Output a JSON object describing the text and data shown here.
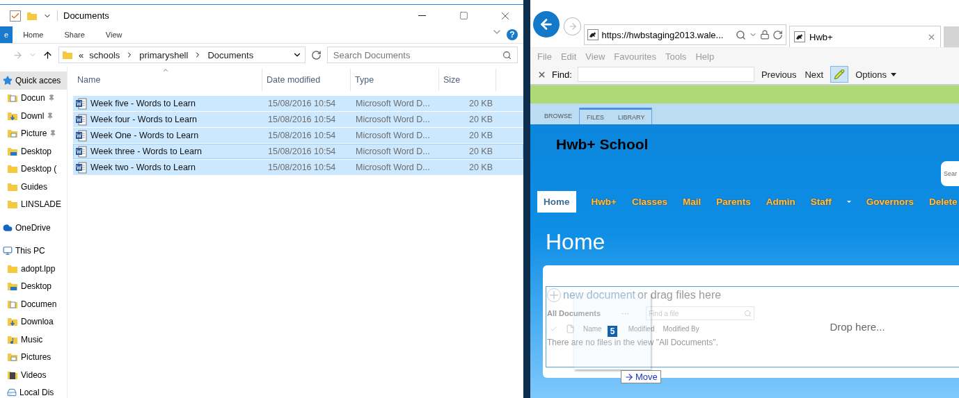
{
  "explorer": {
    "title": "Documents",
    "ribbon_tabs": [
      {
        "label": "e",
        "selected": true
      },
      {
        "label": "Home",
        "selected": false
      },
      {
        "label": "Share",
        "selected": false
      },
      {
        "label": "View",
        "selected": false
      }
    ],
    "help_label": "?",
    "breadcrumb": [
      "schools",
      "primaryshell",
      "Documents"
    ],
    "breadcrumb_overflow": "«",
    "search": {
      "placeholder": "Search Documents"
    },
    "sidebar": [
      {
        "label": "Quick acces",
        "kind": "star",
        "selected": true,
        "children": [
          {
            "label": "Docun",
            "kind": "documents",
            "pinned": true
          },
          {
            "label": "Downl",
            "kind": "downloads",
            "pinned": true
          },
          {
            "label": "Picture",
            "kind": "pictures",
            "pinned": true
          },
          {
            "label": "Desktop",
            "kind": "desktop",
            "pinned": false
          },
          {
            "label": "Desktop (",
            "kind": "folder",
            "pinned": false
          },
          {
            "label": "Guides",
            "kind": "folder",
            "pinned": false
          },
          {
            "label": "LINSLADE",
            "kind": "folder",
            "pinned": false
          }
        ]
      },
      {
        "label": "OneDrive",
        "kind": "cloud",
        "selected": false
      },
      {
        "label": "This PC",
        "kind": "pc",
        "selected": false,
        "children": [
          {
            "label": "adopt.lpp",
            "kind": "folder",
            "pinned": false
          },
          {
            "label": "Desktop",
            "kind": "desktop",
            "pinned": false
          },
          {
            "label": "Documen",
            "kind": "documents",
            "pinned": false
          },
          {
            "label": "Downloa",
            "kind": "downloads",
            "pinned": false
          },
          {
            "label": "Music",
            "kind": "music",
            "pinned": false
          },
          {
            "label": "Pictures",
            "kind": "pictures",
            "pinned": false
          },
          {
            "label": "Videos",
            "kind": "videos",
            "pinned": false
          },
          {
            "label": "Local Dis",
            "kind": "disk",
            "pinned": false
          }
        ]
      }
    ],
    "table": {
      "columns": [
        {
          "label": "Name",
          "sorted": true
        },
        {
          "label": "Date modified",
          "sorted": false
        },
        {
          "label": "Type",
          "sorted": false
        },
        {
          "label": "Size",
          "sorted": false
        }
      ],
      "rows": [
        {
          "name": "Week five - Words to Learn",
          "date": "15/08/2016 10:54",
          "type": "Microsoft Word D...",
          "size": "20 KB",
          "selected": true,
          "focused": false
        },
        {
          "name": "Week four - Words to Learn",
          "date": "15/08/2016 10:54",
          "type": "Microsoft Word D...",
          "size": "20 KB",
          "selected": true,
          "focused": false
        },
        {
          "name": "Week One - Words to Learn",
          "date": "15/08/2016 10:54",
          "type": "Microsoft Word D...",
          "size": "20 KB",
          "selected": true,
          "focused": false
        },
        {
          "name": "Week three - Words to Learn",
          "date": "15/08/2016 10:54",
          "type": "Microsoft Word D...",
          "size": "20 KB",
          "selected": true,
          "focused": true
        },
        {
          "name": "Week two - Words to Learn",
          "date": "15/08/2016 10:54",
          "type": "Microsoft Word D...",
          "size": "20 KB",
          "selected": true,
          "focused": false
        }
      ]
    }
  },
  "browser": {
    "url": "https://hwbstaging2013.wale...",
    "tab": {
      "label": "Hwb+"
    },
    "menu": [
      "File",
      "Edit",
      "View",
      "Favourites",
      "Tools",
      "Help"
    ],
    "find": {
      "label": "Find:",
      "buttons": [
        "Previous",
        "Next"
      ],
      "highlight_on": true,
      "options": "Options"
    }
  },
  "site": {
    "ribbon_tabs": [
      {
        "label": "BROWSE",
        "contextual": false
      },
      {
        "label": "FILES",
        "contextual": true
      },
      {
        "label": "LIBRARY",
        "contextual": true
      }
    ],
    "title": "Hwb+ School",
    "search": {
      "placeholder": "Sear"
    },
    "nav": [
      {
        "label": "Home",
        "selected": true,
        "dropdown": false
      },
      {
        "label": "Hwb+",
        "selected": false,
        "dropdown": false
      },
      {
        "label": "Classes",
        "selected": false,
        "dropdown": false
      },
      {
        "label": "Mail",
        "selected": false,
        "dropdown": false
      },
      {
        "label": "Parents",
        "selected": false,
        "dropdown": false
      },
      {
        "label": "Admin",
        "selected": false,
        "dropdown": false
      },
      {
        "label": "Staff",
        "selected": false,
        "dropdown": true
      },
      {
        "label": "Governors",
        "selected": false,
        "dropdown": false
      },
      {
        "label": "Delete",
        "selected": false,
        "dropdown": false
      }
    ],
    "page_title": "Home",
    "library": {
      "new_link": "new document",
      "new_rest": "or drag files here",
      "view": "All Documents",
      "more": "···",
      "find": {
        "placeholder": "Find a file"
      },
      "columns": [
        "Name",
        "Modified",
        "Modified By"
      ],
      "empty": "There are no files in the view \"All Documents\".",
      "drop": "Drop here..."
    },
    "drag": {
      "count": "5",
      "action": "Move"
    }
  }
}
